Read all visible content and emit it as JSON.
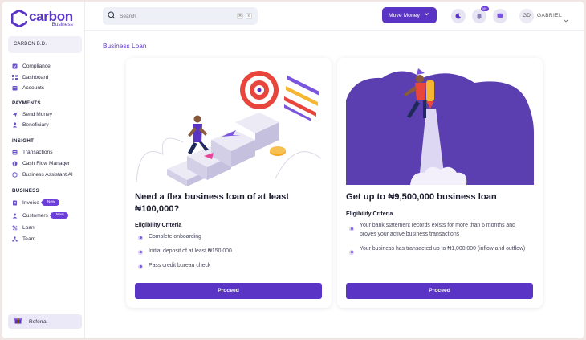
{
  "app": {
    "logo_main": "carbon",
    "logo_sub": "Business",
    "org_name": "CARBON B.D."
  },
  "sidebar": {
    "top_items": [
      {
        "label": "Compliance",
        "icon": "compliance-icon"
      },
      {
        "label": "Dashboard",
        "icon": "dashboard-icon"
      },
      {
        "label": "Accounts",
        "icon": "accounts-icon"
      }
    ],
    "sections": [
      {
        "title": "PAYMENTS",
        "items": [
          {
            "label": "Send Money",
            "icon": "send-icon"
          },
          {
            "label": "Beneficiary",
            "icon": "beneficiary-icon"
          }
        ]
      },
      {
        "title": "INSIGHT",
        "items": [
          {
            "label": "Transactions",
            "icon": "transactions-icon"
          },
          {
            "label": "Cash Flow Manager",
            "icon": "cashflow-icon"
          },
          {
            "label": "Business Assistant AI",
            "icon": "assistant-icon"
          }
        ]
      },
      {
        "title": "BUSINESS",
        "items": [
          {
            "label": "Invoice",
            "icon": "invoice-icon",
            "badge": "New"
          },
          {
            "label": "Customers",
            "icon": "customers-icon",
            "badge": "New"
          },
          {
            "label": "Loan",
            "icon": "loan-icon"
          },
          {
            "label": "Team",
            "icon": "team-icon"
          }
        ]
      }
    ],
    "referral": "Referral"
  },
  "topbar": {
    "search_placeholder": "Search",
    "kbd_1": "⌘",
    "kbd_2": "K",
    "move_money": "Move Money",
    "notification_count": "99+",
    "avatar_initials": "GD",
    "user_name": "GABRIEL"
  },
  "main": {
    "page_title": "Business Loan",
    "cards": [
      {
        "title": "Need a flex business loan of at least ₦100,000?",
        "criteria_title": "Eligibility Criteria",
        "criteria": [
          "Complete onboarding",
          "Initial deposit of at least ₦150,000",
          "Pass credit bureau check"
        ],
        "button": "Proceed"
      },
      {
        "title": "Get up to ₦9,500,000 business loan",
        "criteria_title": "Eligibility Criteria",
        "criteria": [
          "Your bank statement records exists for more than 6 months and proves your active business transactions",
          "Your business has transacted up to ₦1,000,000 (inflow and outflow)"
        ],
        "button": "Proceed"
      }
    ]
  },
  "colors": {
    "brand": "#5a35c5",
    "badge": "#6b3fd8",
    "illustration_purple": "#5b3fb0",
    "accent_red": "#e8453c"
  }
}
